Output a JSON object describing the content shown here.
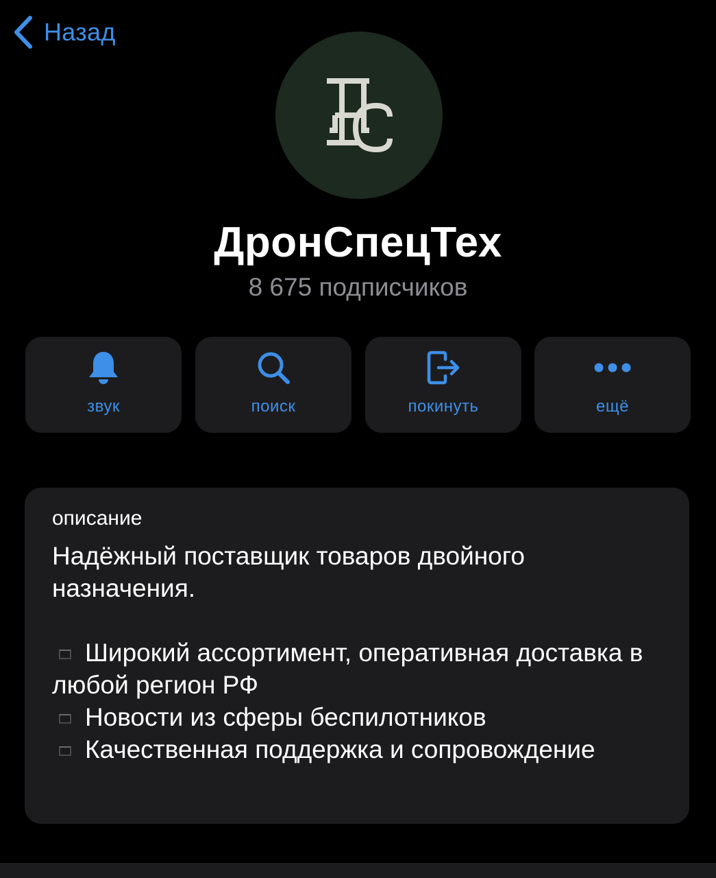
{
  "nav": {
    "back_label": "Назад"
  },
  "channel": {
    "avatar_monogram": "ДСТ",
    "name": "ДронСпецТех",
    "subscribers": "8 675 подписчиков"
  },
  "actions": [
    {
      "label": "звук",
      "icon": "bell-icon"
    },
    {
      "label": "поиск",
      "icon": "search-icon"
    },
    {
      "label": "покинуть",
      "icon": "leave-icon"
    },
    {
      "label": "ещё",
      "icon": "more-icon"
    }
  ],
  "description": {
    "label": "описание",
    "intro": "Надёжный поставщик товаров двойного назначения.",
    "bullets": [
      "Широкий ассортимент, оперативная доставка в любой регион РФ",
      "Новости из сферы беспилотников",
      "Качественная поддержка и сопровождение"
    ]
  },
  "colors": {
    "accent": "#3d8fe8",
    "card": "#1c1c1e",
    "avatar_bg": "#1c2a1f",
    "monogram": "#d8d8d0",
    "muted_text": "#8d8d93"
  }
}
